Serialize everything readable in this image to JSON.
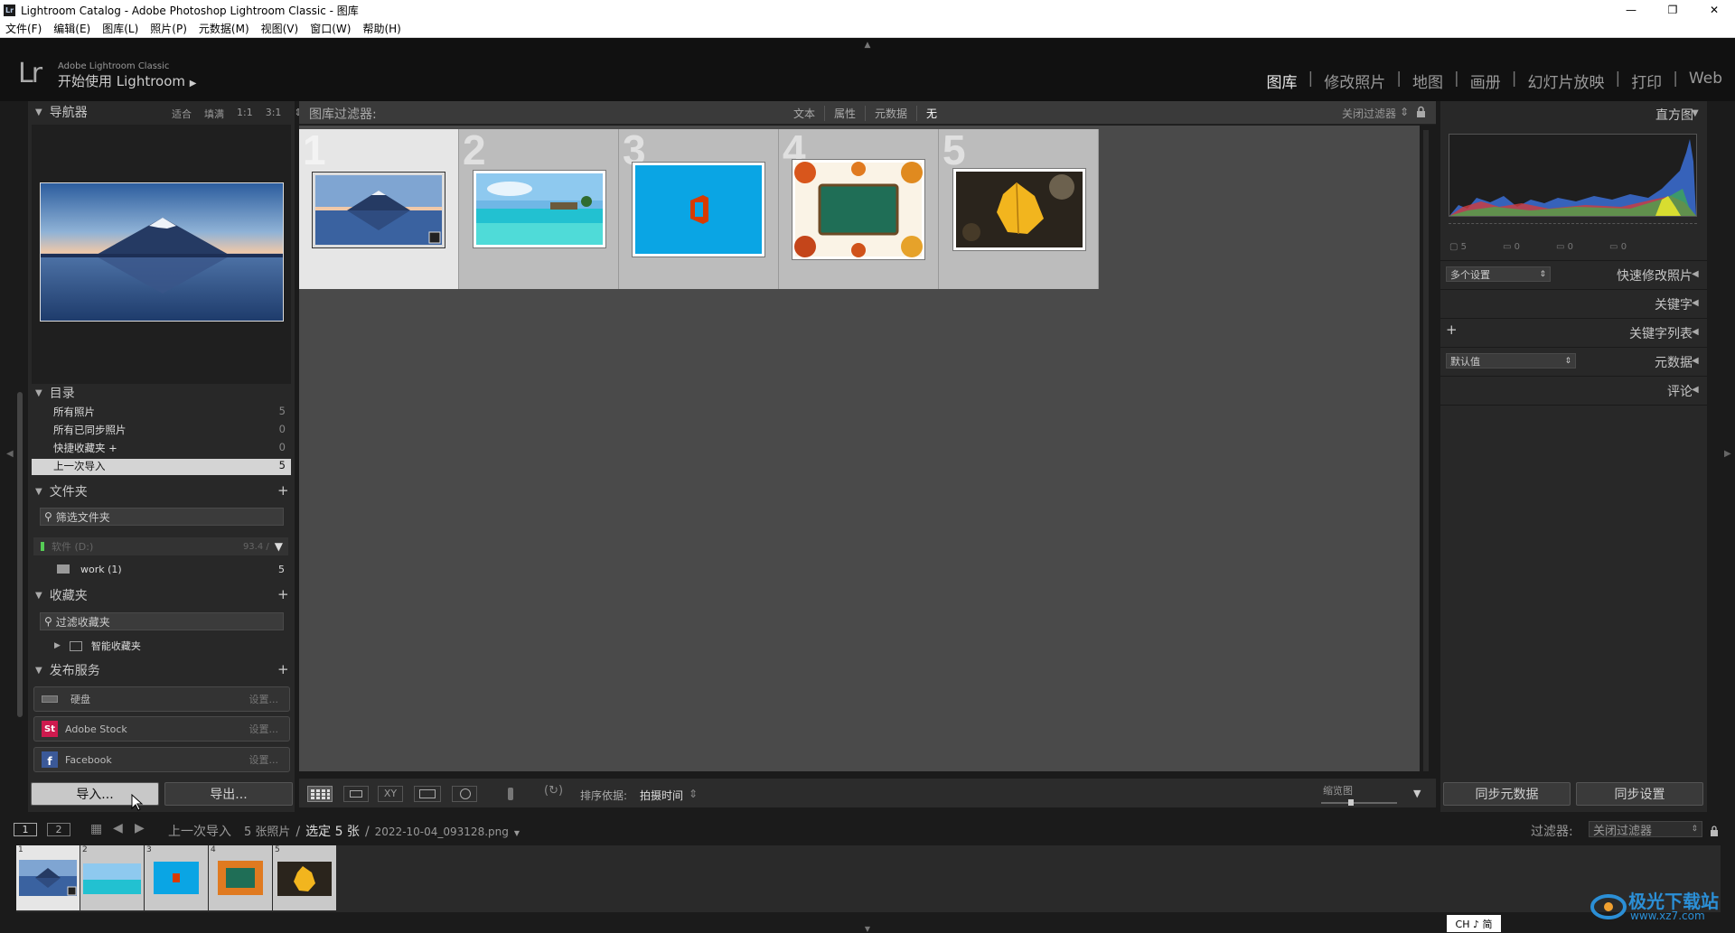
{
  "window": {
    "title": "Lightroom Catalog - Adobe Photoshop Lightroom Classic - 图库",
    "minimize": "—",
    "restore": "❐",
    "close": "✕"
  },
  "menu": [
    "文件(F)",
    "编辑(E)",
    "图库(L)",
    "照片(P)",
    "元数据(M)",
    "视图(V)",
    "窗口(W)",
    "帮助(H)"
  ],
  "identity": {
    "logo": "Lr",
    "product": "Adobe Lightroom Classic",
    "tagline": "开始使用 Lightroom",
    "tagline_arrow": "▶"
  },
  "modules": [
    "图库",
    "修改照片",
    "地图",
    "画册",
    "幻灯片放映",
    "打印",
    "Web"
  ],
  "modules_sep": "|",
  "navigator": {
    "title": "导航器",
    "zoom_options": [
      "适合",
      "填满",
      "1:1",
      "3:1"
    ],
    "zoom_menu": "⇕"
  },
  "catalog": {
    "title": "目录",
    "items": [
      {
        "label": "所有照片",
        "count": "5"
      },
      {
        "label": "所有已同步照片",
        "count": "0"
      },
      {
        "label": "快捷收藏夹 +",
        "count": "0"
      },
      {
        "label": "上一次导入",
        "count": "5"
      }
    ]
  },
  "folders": {
    "title": "文件夹",
    "add": "+",
    "filter_placeholder": "筛选文件夹",
    "volume_label": "软件 (D:)",
    "volume_size": "93.4 / ",
    "subfolder": "work (1)",
    "subfolder_count": "5"
  },
  "collections": {
    "title": "收藏夹",
    "add": "+",
    "filter_placeholder": "过滤收藏夹",
    "smart": "智能收藏夹"
  },
  "publish": {
    "title": "发布服务",
    "add": "+",
    "services": [
      {
        "name": "硬盘",
        "action": "设置..."
      },
      {
        "name": "Adobe Stock",
        "action": "设置..."
      },
      {
        "name": "Facebook",
        "action": "设置..."
      }
    ]
  },
  "left_buttons": {
    "import": "导入...",
    "export": "导出..."
  },
  "filter_bar": {
    "label": "图库过滤器:",
    "options": [
      "文本",
      "属性",
      "元数据",
      "无"
    ],
    "active": "无",
    "preset": "关闭过滤器",
    "preset_arrow": "⇕"
  },
  "grid": {
    "photos": [
      {
        "index": "1"
      },
      {
        "index": "2"
      },
      {
        "index": "3"
      },
      {
        "index": "4"
      },
      {
        "index": "5"
      }
    ]
  },
  "toolbar": {
    "sort_label": "排序依据:",
    "sort_value": "拍摄时间",
    "sort_arrow": "⇕",
    "thumb_label": "缩览图",
    "toggle_arrow": "▼"
  },
  "histogram": {
    "title": "直方图",
    "stats": [
      "5",
      "0",
      "0",
      "0"
    ]
  },
  "right_panels": {
    "quick_develop": "快速修改照片",
    "preset_select": "多个设置",
    "keywords": "关键字",
    "keyword_list": "关键字列表",
    "keyword_add": "+",
    "metadata": "元数据",
    "metadata_select": "默认值",
    "comments": "评论",
    "collapse": "◀",
    "select_arrow": "⇕"
  },
  "right_buttons": {
    "sync_metadata": "同步元数据",
    "sync_settings": "同步设置"
  },
  "secondary_bar": {
    "screen1": "1",
    "screen2": "2",
    "source": "上一次导入",
    "count": "5 张照片",
    "selected": "选定 5 张",
    "filename": "2022-10-04_093128.png",
    "filename_arrow": "▼",
    "sep": "/",
    "filter_label": "过滤器:",
    "filter_value": "关闭过滤器"
  },
  "filmstrip": {
    "indices": [
      "1",
      "2",
      "3",
      "4",
      "5"
    ]
  },
  "ime": "CH ♪ 简",
  "watermark": {
    "name": "极光下载站",
    "url": "www.xz7.com"
  },
  "colors": {
    "accent": "#e6e6e6",
    "panel": "#282828",
    "grid_bg": "#4a4a4a",
    "office_red": "#d83b01",
    "sky_blue": "#0aa5e4"
  }
}
